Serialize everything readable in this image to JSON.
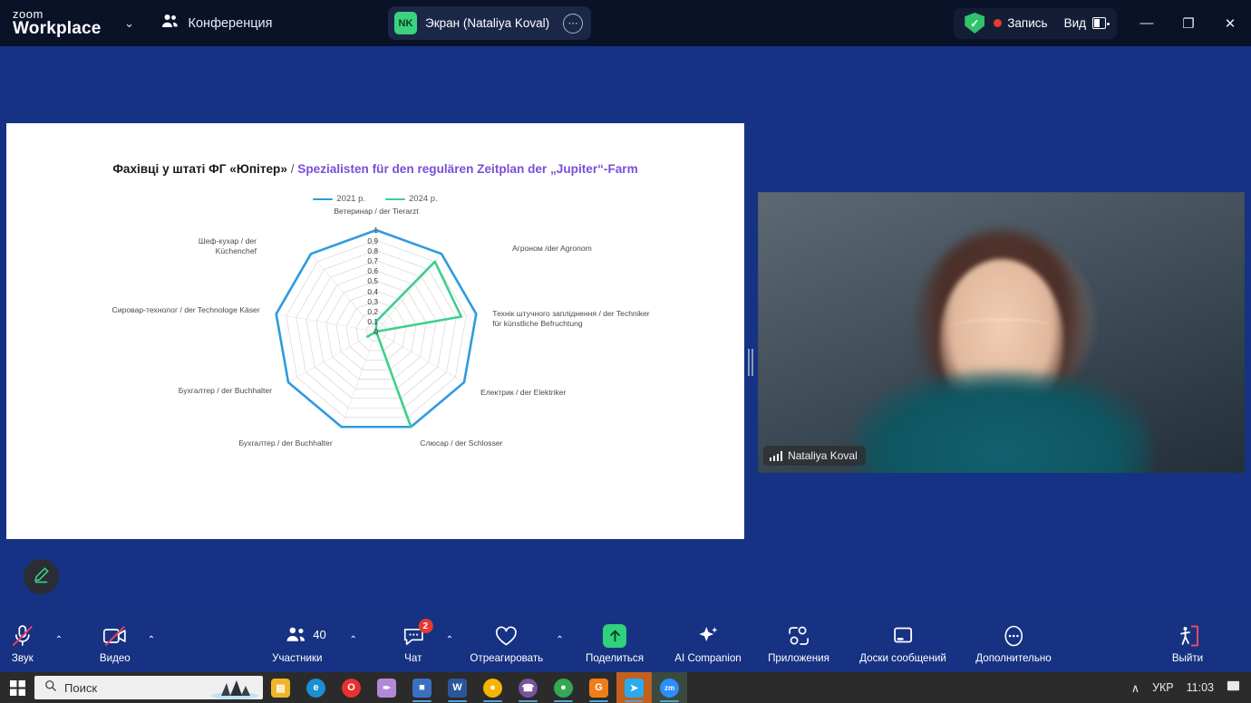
{
  "titlebar": {
    "logo_line1": "zoom",
    "logo_line2": "Workplace",
    "chevron": "⌄",
    "meeting_label": "Конференция",
    "share_pill": {
      "avatar_initials": "NK",
      "text": "Экран (Nataliya Koval)",
      "more": "⋯"
    },
    "recording_label": "Запись",
    "view_label": "Вид",
    "minimize": "—",
    "maximize": "❐",
    "close": "✕"
  },
  "video": {
    "participant_name": "Nataliya Koval"
  },
  "annotate": {
    "label": "pencil-icon"
  },
  "toolbar": {
    "items": [
      {
        "label": "Звук",
        "icon": "microphone-muted-icon",
        "caret": true,
        "count": null,
        "badge": null
      },
      {
        "label": "Видео",
        "icon": "camera-muted-icon",
        "caret": true,
        "count": null,
        "badge": null
      },
      {
        "label": "Участники",
        "icon": "participants-icon",
        "caret": true,
        "count": "40",
        "badge": null
      },
      {
        "label": "Чат",
        "icon": "chat-icon",
        "caret": true,
        "count": null,
        "badge": "2"
      },
      {
        "label": "Отреагировать",
        "icon": "heart-icon",
        "caret": true,
        "count": null,
        "badge": null
      },
      {
        "label": "Поделиться",
        "icon": "share-screen-icon",
        "caret": false,
        "count": null,
        "badge": null
      },
      {
        "label": "AI Companion",
        "icon": "sparkle-icon",
        "caret": false,
        "count": null,
        "badge": null
      },
      {
        "label": "Приложения",
        "icon": "apps-icon",
        "caret": false,
        "count": null,
        "badge": null
      },
      {
        "label": "Доски сообщений",
        "icon": "whiteboard-icon",
        "caret": false,
        "count": null,
        "badge": null
      },
      {
        "label": "Дополнительно",
        "icon": "more-icon",
        "caret": false,
        "count": null,
        "badge": null
      },
      {
        "label": "Выйти",
        "icon": "leave-icon",
        "caret": false,
        "count": null,
        "badge": null
      }
    ]
  },
  "taskbar": {
    "start_icon": "windows-start-icon",
    "search_placeholder": "Поиск",
    "apps": [
      {
        "name": "file-explorer-icon",
        "color": "#f0b429",
        "glyph": "▤",
        "open": false
      },
      {
        "name": "microsoft-edge-icon",
        "color": "#1a8fd1",
        "glyph": "e",
        "open": false
      },
      {
        "name": "opera-icon",
        "color": "#e8312f",
        "glyph": "O",
        "open": false
      },
      {
        "name": "feather-editor-icon",
        "color": "#b08ad8",
        "glyph": "✒",
        "open": false
      },
      {
        "name": "save-app-icon",
        "color": "#3b6fc4",
        "glyph": "■",
        "open": true
      },
      {
        "name": "microsoft-word-icon",
        "color": "#2b579a",
        "glyph": "W",
        "open": true
      },
      {
        "name": "google-chrome-icon",
        "color": "#f4b400",
        "glyph": "●",
        "open": true
      },
      {
        "name": "viber-icon",
        "color": "#7b519d",
        "glyph": "☎",
        "open": true
      },
      {
        "name": "chrome-profile-icon",
        "color": "#34a853",
        "glyph": "●",
        "open": true
      },
      {
        "name": "gravit-icon",
        "color": "#f07d1a",
        "glyph": "G",
        "open": true
      },
      {
        "name": "telegram-icon",
        "color": "#2aabee",
        "glyph": "➤",
        "open": true
      },
      {
        "name": "zoom-icon",
        "color": "#2d8cff",
        "glyph": "zm",
        "open": true
      }
    ],
    "tray_chevron": "∧",
    "language": "УКР",
    "clock": "11:03",
    "notification_icon": "notifications-icon"
  },
  "chart_data": {
    "type": "radar",
    "title_uk": "Фахівці у штаті ФГ «Юпітер»",
    "title_sep": " / ",
    "title_de": "Spezialisten für den regulären Zeitplan der „Jupiter“-Farm",
    "title_color_uk": "#1a1a1a",
    "title_color_de": "#7a4fd6",
    "categories": [
      "Ветеринар / der Tierarzt",
      "Агроном /der Agronom",
      "Технік штучного запліднення / der Techniker für künstliche Befruchtung",
      "Електрик / der Elektriker",
      "Слюсар / der Schlosser",
      "Бухгалтер / der Buchhalter",
      "Бухгалтер / der Buchhalter",
      "Сировар-технолог / der Technologe Käser",
      "Шеф-кухар / der Küchenchef"
    ],
    "series": [
      {
        "name": "2021 р.",
        "color": "#2f9ae0",
        "values": [
          1,
          1,
          1,
          1,
          1,
          1,
          1,
          1,
          1
        ]
      },
      {
        "name": "2024 р.",
        "color": "#3ecf8e",
        "values": [
          0.1,
          0.9,
          0.85,
          0,
          1,
          0,
          0.1,
          0,
          0
        ]
      }
    ],
    "tick_labels": [
      "1",
      "0,9",
      "0,8",
      "0,7",
      "0,6",
      "0,5",
      "0,4",
      "0,3",
      "0,2",
      "0,1",
      "0"
    ],
    "rlim": [
      0,
      1
    ],
    "grid": true,
    "legend_position": "top"
  }
}
